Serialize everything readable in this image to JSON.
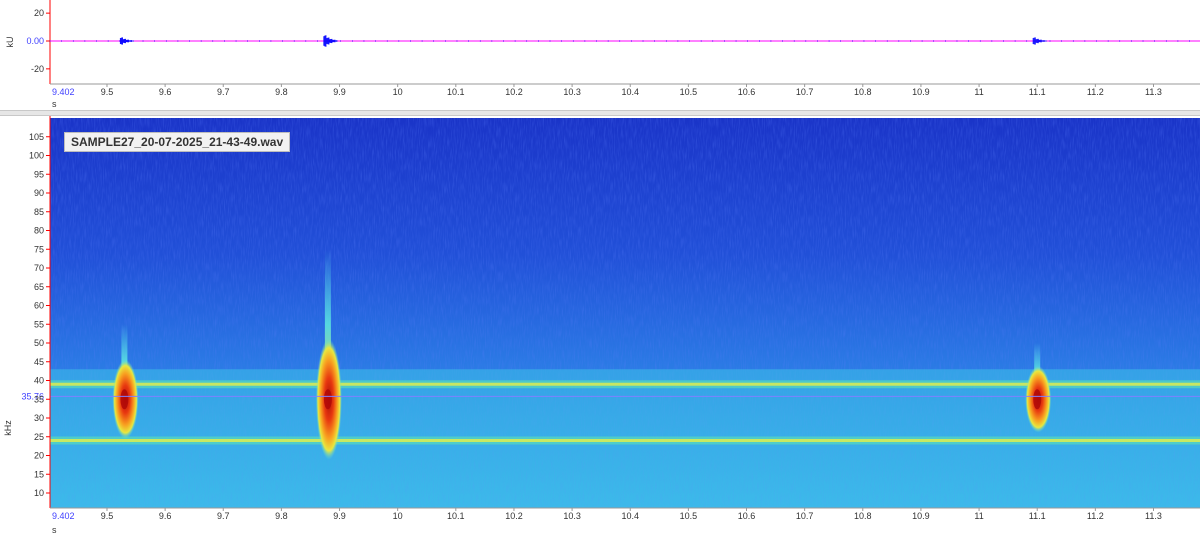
{
  "waveform": {
    "ylabel": "kU",
    "xlabel": "s",
    "ylim": [
      -28,
      28
    ],
    "y_ticks": [
      20,
      0,
      -20
    ],
    "y_tick_labels": [
      "20",
      "0.00",
      "-20"
    ],
    "bursts_s": [
      9.53,
      9.88,
      11.1
    ],
    "colors": {
      "trace": "#0000ff",
      "zero_line": "#ff00ff",
      "axis": "#ff0000"
    }
  },
  "spectrogram": {
    "ylabel": "kHz",
    "xlabel": "s",
    "file_label": "SAMPLE27_20-07-2025_21-43-49.wav",
    "cursor_label": "35.76",
    "cursor_khz": 35.76,
    "ylim": [
      6,
      110
    ],
    "y_ticks": [
      10,
      15,
      20,
      25,
      30,
      35,
      40,
      45,
      50,
      55,
      60,
      65,
      70,
      75,
      80,
      85,
      90,
      95,
      100,
      105
    ],
    "colors": {
      "background": "#1f4fd4",
      "band": "#3ecfe8",
      "hot": "#e03010",
      "cursor": "#8080ff"
    }
  },
  "time_axis": {
    "xlim": [
      9.402,
      11.38
    ],
    "start_label": "9.402",
    "ticks": [
      9.5,
      9.6,
      9.7,
      9.8,
      9.9,
      10.0,
      10.1,
      10.2,
      10.3,
      10.4,
      10.5,
      10.6,
      10.7,
      10.8,
      10.9,
      11.0,
      11.1,
      11.2,
      11.3
    ],
    "tick_labels": [
      "9.5",
      "9.6",
      "9.7",
      "9.8",
      "9.9",
      "10",
      "10.1",
      "10.2",
      "10.3",
      "10.4",
      "10.5",
      "10.6",
      "10.7",
      "10.8",
      "10.9",
      "11",
      "11.1",
      "11.2",
      "11.3"
    ]
  },
  "chart_data": [
    {
      "type": "line",
      "xlabel": "s",
      "ylabel": "kU",
      "xlim": [
        9.402,
        11.38
      ],
      "ylim": [
        -28,
        28
      ],
      "series": [
        {
          "x": [
            9.402,
            9.52,
            9.53,
            9.545,
            9.87,
            9.88,
            9.895,
            11.09,
            11.1,
            11.115,
            11.38
          ],
          "values": [
            0,
            0,
            2,
            0,
            0,
            4,
            0,
            0,
            2,
            0,
            0
          ]
        }
      ]
    },
    {
      "type": "heatmap",
      "xlabel": "s",
      "ylabel": "kHz",
      "xlim": [
        9.402,
        11.38
      ],
      "ylim": [
        6,
        110
      ],
      "title": "SAMPLE27_20-07-2025_21-43-49.wav",
      "calls": [
        {
          "t": 9.53,
          "f_low": 25,
          "f_peak": 35,
          "f_high": 55
        },
        {
          "t": 9.88,
          "f_low": 25,
          "f_peak": 35,
          "f_high": 75
        },
        {
          "t": 11.1,
          "f_low": 26,
          "f_peak": 35,
          "f_high": 50
        }
      ],
      "noise_bands_khz": [
        24,
        39
      ],
      "cursor_khz": 35.76
    }
  ]
}
